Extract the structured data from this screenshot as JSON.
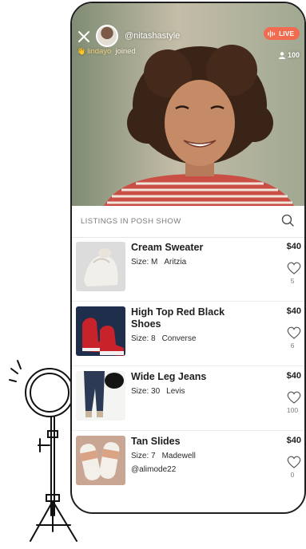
{
  "stream": {
    "host": "@nitashastyle",
    "joined_user": "lindayo",
    "joined_text": "joined",
    "live_label": "LIVE",
    "viewer_count": "100"
  },
  "listings": {
    "header": "LISTINGS IN POSH SHOW",
    "items": [
      {
        "title": "Cream Sweater",
        "size": "Size: M",
        "brand": "Aritzia",
        "seller": "",
        "price": "$40",
        "likes": "5"
      },
      {
        "title": "High Top Red Black Shoes",
        "size": "Size: 8",
        "brand": "Converse",
        "seller": "",
        "price": "$40",
        "likes": "6"
      },
      {
        "title": "Wide Leg Jeans",
        "size": "Size: 30",
        "brand": "Levis",
        "seller": "",
        "price": "$40",
        "likes": "100"
      },
      {
        "title": "Tan Slides",
        "size": "Size: 7",
        "brand": "Madewell",
        "seller": "@alimode22",
        "price": "$40",
        "likes": "0"
      }
    ]
  },
  "colors": {
    "live_badge": "#f06b4f",
    "frame": "#1e1e1e",
    "muted_text": "#7a7a7a"
  },
  "icons": {
    "close": "close-icon",
    "live": "live-wave-icon",
    "viewers": "person-icon",
    "search": "search-icon",
    "like": "heart-icon",
    "wave": "waving-hand-icon"
  }
}
